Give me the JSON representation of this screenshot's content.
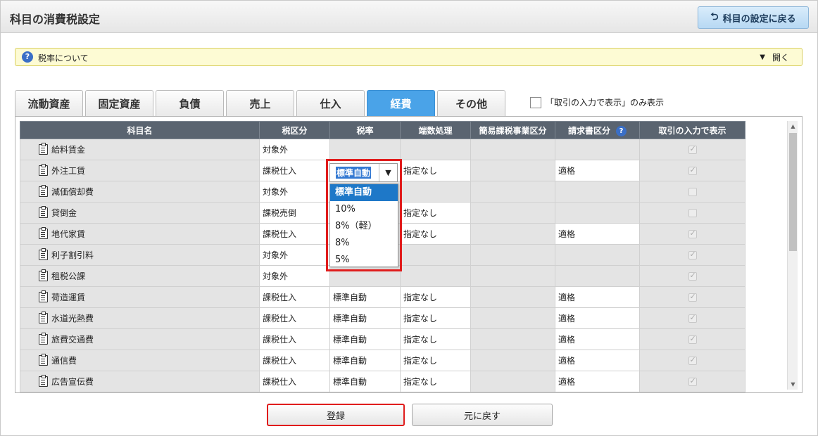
{
  "header": {
    "title": "科目の消費税設定",
    "back_label": "科目の設定に戻る"
  },
  "info": {
    "text": "税率について",
    "toggle_label": "開く"
  },
  "tabs": [
    {
      "label": "流動資産",
      "active": false
    },
    {
      "label": "固定資産",
      "active": false
    },
    {
      "label": "負債",
      "active": false
    },
    {
      "label": "売上",
      "active": false
    },
    {
      "label": "仕入",
      "active": false
    },
    {
      "label": "経費",
      "active": true
    },
    {
      "label": "その他",
      "active": false
    }
  ],
  "filter_label": "「取引の入力で表示」のみ表示",
  "columns": [
    "科目名",
    "税区分",
    "税率",
    "端数処理",
    "簡易課税事業区分",
    "請求書区分",
    "取引の入力で表示"
  ],
  "rows": [
    {
      "name": "給料賃金",
      "tax": "対象外",
      "rate": "",
      "rounding": "",
      "simple": "",
      "invoice": "",
      "show": true
    },
    {
      "name": "外注工賃",
      "tax": "課税仕入",
      "rate": "",
      "rounding": "指定なし",
      "simple": "",
      "invoice": "適格",
      "show": true
    },
    {
      "name": "減価償却費",
      "tax": "対象外",
      "rate": "",
      "rounding": "",
      "simple": "",
      "invoice": "",
      "show": false
    },
    {
      "name": "貸倒金",
      "tax": "課税売倒",
      "rate": "",
      "rounding": "指定なし",
      "simple": "",
      "invoice": "",
      "show": false
    },
    {
      "name": "地代家賃",
      "tax": "課税仕入",
      "rate": "",
      "rounding": "指定なし",
      "simple": "",
      "invoice": "適格",
      "show": true
    },
    {
      "name": "利子割引料",
      "tax": "対象外",
      "rate": "",
      "rounding": "",
      "simple": "",
      "invoice": "",
      "show": true
    },
    {
      "name": "租税公課",
      "tax": "対象外",
      "rate": "",
      "rounding": "",
      "simple": "",
      "invoice": "",
      "show": true
    },
    {
      "name": "荷造運賃",
      "tax": "課税仕入",
      "rate": "標準自動",
      "rounding": "指定なし",
      "simple": "",
      "invoice": "適格",
      "show": true
    },
    {
      "name": "水道光熱費",
      "tax": "課税仕入",
      "rate": "標準自動",
      "rounding": "指定なし",
      "simple": "",
      "invoice": "適格",
      "show": true
    },
    {
      "name": "旅費交通費",
      "tax": "課税仕入",
      "rate": "標準自動",
      "rounding": "指定なし",
      "simple": "",
      "invoice": "適格",
      "show": true
    },
    {
      "name": "通信費",
      "tax": "課税仕入",
      "rate": "標準自動",
      "rounding": "指定なし",
      "simple": "",
      "invoice": "適格",
      "show": true
    },
    {
      "name": "広告宣伝費",
      "tax": "課税仕入",
      "rate": "標準自動",
      "rounding": "指定なし",
      "simple": "",
      "invoice": "適格",
      "show": true
    }
  ],
  "rate_select": {
    "value": "標準自動",
    "options": [
      "標準自動",
      "10%",
      "8%（軽）",
      "8%",
      "5%"
    ]
  },
  "buttons": {
    "register": "登録",
    "reset": "元に戻す"
  }
}
